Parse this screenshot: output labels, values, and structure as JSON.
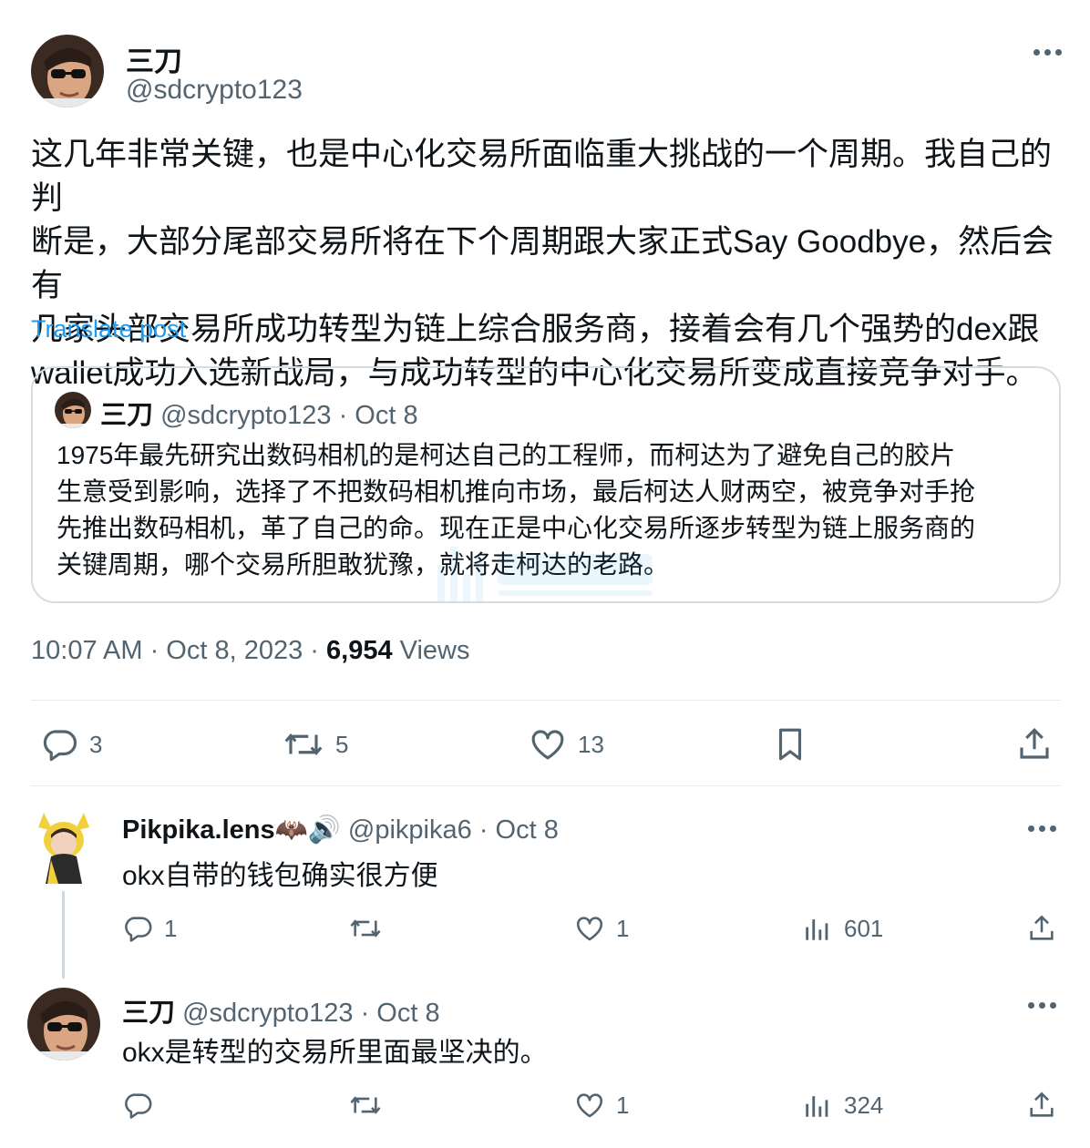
{
  "main_tweet": {
    "display_name": "三刀",
    "handle": "@sdcrypto123",
    "text_lines": [
      "这几年非常关键，也是中心化交易所面临重大挑战的一个周期。我自己的判",
      "断是，大部分尾部交易所将在下个周期跟大家正式Say Goodbye，然后会有",
      "几家头部交易所成功转型为链上综合服务商，接着会有几个强势的dex跟",
      "wallet成功入选新战局，与成功转型的中心化交易所变成直接竞争对手。"
    ],
    "translate_label": "Translate post",
    "quote": {
      "display_name": "三刀",
      "handle": "@sdcrypto123",
      "date": "· Oct 8",
      "text_lines": [
        "1975年最先研究出数码相机的是柯达自己的工程师，而柯达为了避免自己的胶片",
        "生意受到影响，选择了不把数码相机推向市场，最后柯达人财两空，被竞争对手抢",
        "先推出数码相机，革了自己的命。现在正是中心化交易所逐步转型为链上服务商的",
        "关键周期，哪个交易所胆敢犹豫，就将走柯达的老路。"
      ]
    },
    "timestamp": "10:07 AM · Oct 8, 2023 ·",
    "views_count": "6,954",
    "views_label": "Views",
    "actions": {
      "replies": "3",
      "retweets": "5",
      "likes": "13"
    }
  },
  "replies": [
    {
      "display_name": "Pikpika.lens🦇🔊",
      "handle": "@pikpika6",
      "date": "· Oct 8",
      "text": "okx自带的钱包确实很方便",
      "actions": {
        "replies": "1",
        "retweets": "",
        "likes": "1",
        "views": "601"
      }
    },
    {
      "display_name": "三刀",
      "handle": "@sdcrypto123",
      "date": "· Oct 8",
      "text": "okx是转型的交易所里面最坚决的。",
      "actions": {
        "replies": "",
        "retweets": "",
        "likes": "1",
        "views": "324"
      }
    }
  ],
  "colors": {
    "text": "#0f1419",
    "muted": "#536471",
    "link": "#1d9bf0",
    "border": "#d6dde2"
  }
}
